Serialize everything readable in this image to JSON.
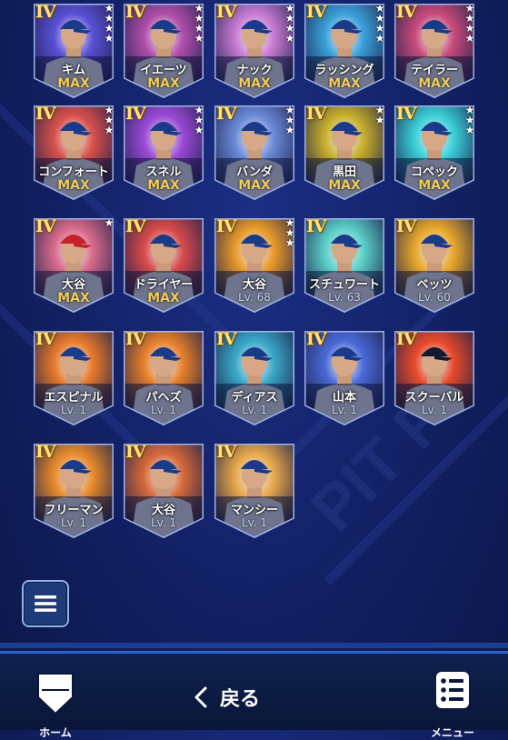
{
  "players": [
    {
      "name": "キム",
      "level": "MAX",
      "tier": "IV",
      "stars": 4,
      "bg": "#5a4fd6",
      "jersey": "#e8ecf3",
      "cap": "#1a3a8a"
    },
    {
      "name": "イエーツ",
      "level": "MAX",
      "tier": "IV",
      "stars": 4,
      "bg": "#b04eaa",
      "jersey": "#e8ecf3",
      "cap": "#1a3a8a"
    },
    {
      "name": "ナック",
      "level": "MAX",
      "tier": "IV",
      "stars": 4,
      "bg": "#c87ad2",
      "jersey": "#e8ecf3",
      "cap": "#1a3a8a"
    },
    {
      "name": "ラッシング",
      "level": "MAX",
      "tier": "IV",
      "stars": 4,
      "bg": "#3aa0d8",
      "jersey": "#e8ecf3",
      "cap": "#1a3a8a"
    },
    {
      "name": "テイラー",
      "level": "MAX",
      "tier": "IV",
      "stars": 4,
      "bg": "#c84a7a",
      "jersey": "#e8ecf3",
      "cap": "#1a3a8a"
    },
    {
      "name": "コンフォート",
      "level": "MAX",
      "tier": "IV",
      "stars": 3,
      "bg": "#d8504a",
      "jersey": "#e8ecf3",
      "cap": "#1a3a8a"
    },
    {
      "name": "スネル",
      "level": "MAX",
      "tier": "IV",
      "stars": 3,
      "bg": "#9a4ad6",
      "jersey": "#e8ecf3",
      "cap": "#1a3a8a"
    },
    {
      "name": "バンダ",
      "level": "MAX",
      "tier": "IV",
      "stars": 3,
      "bg": "#6a8ad8",
      "jersey": "#e8ecf3",
      "cap": "#1a3a8a"
    },
    {
      "name": "黒田",
      "level": "MAX",
      "tier": "IV",
      "stars": 2,
      "bg": "#c8b02a",
      "jersey": "#e8ecf3",
      "cap": "#1a3a8a"
    },
    {
      "name": "コペック",
      "level": "MAX",
      "tier": "IV",
      "stars": 3,
      "bg": "#3ad0d8",
      "jersey": "#e8ecf3",
      "cap": "#1a3a8a"
    },
    {
      "name": "大谷",
      "level": "MAX",
      "tier": "IV",
      "stars": 1,
      "bg": "#d86a8a",
      "jersey": "#e8ecf3",
      "cap": "#c8202a"
    },
    {
      "name": "ドライヤー",
      "level": "MAX",
      "tier": "IV",
      "stars": 0,
      "bg": "#d84a4a",
      "jersey": "#e8ecf3",
      "cap": "#1a3a8a"
    },
    {
      "name": "大谷",
      "level": "Lv. 68",
      "tier": "IV",
      "stars": 3,
      "bg": "#e89a2a",
      "jersey": "#e8ecf3",
      "cap": "#1a3a8a"
    },
    {
      "name": "スチュワート",
      "level": "Lv. 63",
      "tier": "IV",
      "stars": 0,
      "bg": "#5ad0c8",
      "jersey": "#e8ecf3",
      "cap": "#1a3a8a"
    },
    {
      "name": "ベッツ",
      "level": "Lv. 60",
      "tier": "IV",
      "stars": 0,
      "bg": "#e8a82a",
      "jersey": "#e8ecf3",
      "cap": "#1a3a8a"
    },
    {
      "name": "エスピナル",
      "level": "Lv. 1",
      "tier": "IV",
      "stars": 0,
      "bg": "#e87a2a",
      "jersey": "#e8ecf3",
      "cap": "#1a3a8a"
    },
    {
      "name": "パヘズ",
      "level": "Lv. 1",
      "tier": "IV",
      "stars": 0,
      "bg": "#e8802a",
      "jersey": "#e8ecf3",
      "cap": "#1a3a8a"
    },
    {
      "name": "ディアス",
      "level": "Lv. 1",
      "tier": "IV",
      "stars": 0,
      "bg": "#3aa8c8",
      "jersey": "#e8ecf3",
      "cap": "#1a3a8a"
    },
    {
      "name": "山本",
      "level": "Lv. 1",
      "tier": "IV",
      "stars": 0,
      "bg": "#4a6ad8",
      "jersey": "#e8ecf3",
      "cap": "#1a3a8a"
    },
    {
      "name": "スクーバル",
      "level": "Lv. 1",
      "tier": "IV",
      "stars": 0,
      "bg": "#e84a2a",
      "jersey": "#e8ecf3",
      "cap": "#111a2e"
    },
    {
      "name": "フリーマン",
      "level": "Lv. 1",
      "tier": "IV",
      "stars": 0,
      "bg": "#e88a2a",
      "jersey": "#e8ecf3",
      "cap": "#1a3a8a"
    },
    {
      "name": "大谷",
      "level": "Lv. 1",
      "tier": "IV",
      "stars": 0,
      "bg": "#d86a3a",
      "jersey": "#e8ecf3",
      "cap": "#1a3a8a"
    },
    {
      "name": "マンシー",
      "level": "Lv. 1",
      "tier": "IV",
      "stars": 0,
      "bg": "#e8a84a",
      "jersey": "#e8ecf3",
      "cap": "#1a3a8a"
    }
  ],
  "nav": {
    "home_label": "ホーム",
    "back_label": "戻る",
    "menu_label": "メニュー"
  },
  "colors": {
    "accent": "#2f63c8",
    "gold": "#f1cc5a"
  }
}
